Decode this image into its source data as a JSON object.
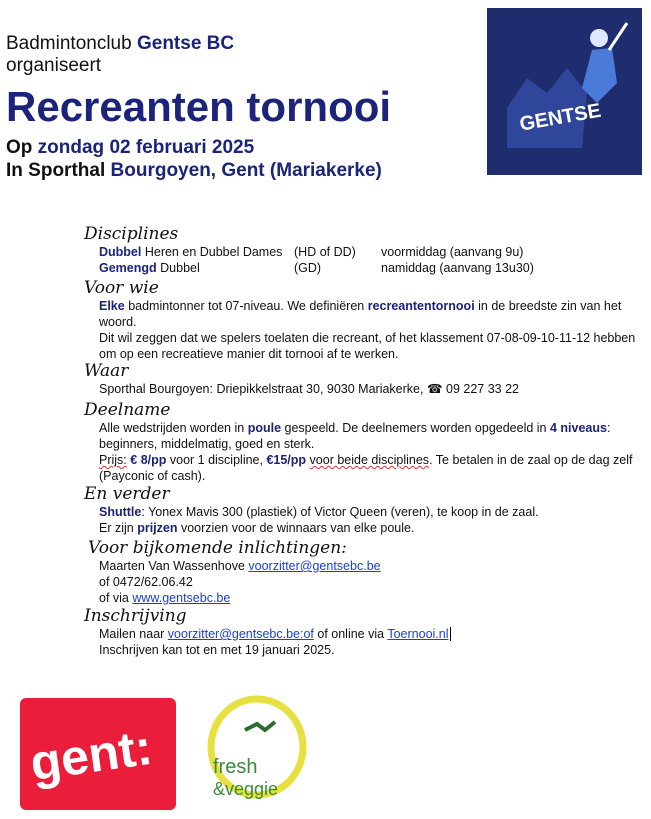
{
  "header": {
    "club_prefix": "Badmintonclub",
    "club_name": "Gentse BC",
    "organiseert": "organiseert",
    "title": "Recreanten tornooi",
    "date_prefix": "Op",
    "date": "zondag 02 februari 2025",
    "place_prefix": "In Sporthal",
    "place": "Bourgoyen, Gent (Mariakerke)",
    "logo_text": "GENTSE BC"
  },
  "disciplines": {
    "heading": "Disciplines",
    "rows": [
      {
        "bold": "Dubbel",
        "text": "Heren en Dubbel Dames",
        "code": "(HD of DD)",
        "time": "voormiddag (aanvang 9u)"
      },
      {
        "bold": "Gemengd",
        "text": "Dubbel",
        "code": "(GD)",
        "time": "namiddag (aanvang 13u30)"
      }
    ]
  },
  "voorwie": {
    "heading": "Voor wie",
    "b1": "Elke",
    "t1": " badmintonner tot 07-niveau. We definiëren ",
    "b2": "recreantentornooi",
    "t2": " in de breedste zin van het woord.",
    "line2": "Dit wil zeggen dat we spelers toelaten die recreant, of het klassement 07-08-09-10-11-12 hebben om op een recreatieve manier dit tornooi af te werken."
  },
  "waar": {
    "heading": "Waar",
    "text": "Sporthal Bourgoyen: Driepikkelstraat 30, 9030 Mariakerke, ☎ 09 227 33 22"
  },
  "deelname": {
    "heading": "Deelname",
    "t1": "Alle wedstrijden worden in ",
    "b1": "poule",
    "t2": " gespeeld. De deelnemers worden opgedeeld in ",
    "b2": "4 niveaus",
    "t3": ": beginners, middelmatig, goed en sterk.",
    "prijs": "Prijs:",
    "b3": "€ 8/pp",
    "t4": " voor 1 discipline, ",
    "b4": "€15/pp",
    "t5": "voor beide disciplines",
    "t6": ". Te betalen in de zaal op de dag zelf (Payconic of cash)."
  },
  "verder": {
    "heading": "En verder",
    "b1": "Shuttle",
    "t1": ": Yonex Mavis 300 (plastiek) of Victor Queen (veren), te koop in de zaal.",
    "t2": "Er zijn ",
    "b2": "prijzen",
    "t3": " voorzien voor de winnaars van elke poule."
  },
  "info": {
    "heading": "Voor bijkomende inlichtingen:",
    "name": "Maarten Van Wassenhove ",
    "email": "voorzitter@gentsebc.be",
    "phone": "of 0472/62.06.42",
    "via": "of via ",
    "site": "www.gentsebc.be"
  },
  "inschrijving": {
    "heading": "Inschrijving",
    "t1": "Mailen naar ",
    "email": "voorzitter@gentsebc.be:of",
    "t2": " of online via ",
    "link": "Toernooi.nl",
    "deadline": "Inschrijven kan tot en met 19 januari 2025."
  },
  "logos": {
    "gent": "gent:",
    "fresh": "fresh",
    "veggie": "&veggie"
  },
  "colors": {
    "navy": "#1b237a",
    "red": "#ea1d3b",
    "link": "#1a3fd6"
  }
}
